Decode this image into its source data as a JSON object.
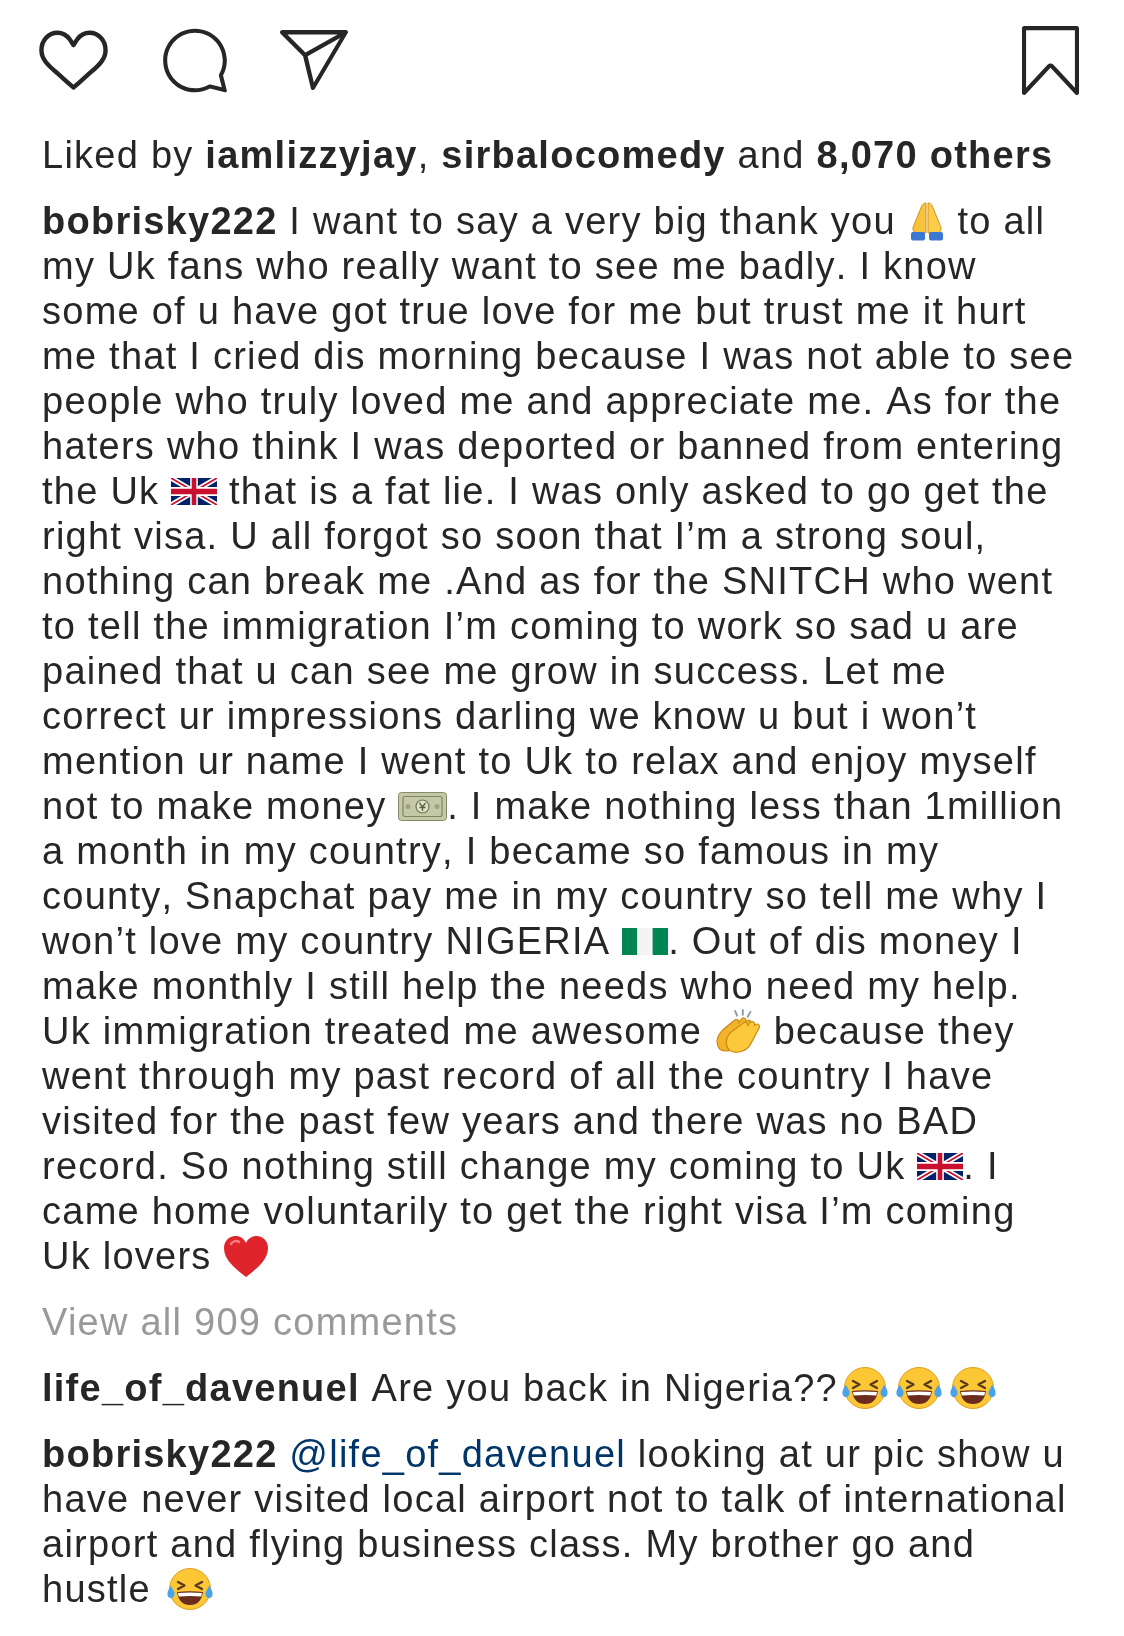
{
  "likes": {
    "text": "Liked by **iamlizzyjay**, **sirbalocomedy** and **8,070 others**"
  },
  "caption": {
    "segments": [
      {
        "kind": "text",
        "text": "**bobrisky222** I want to say a very big thank you "
      },
      {
        "kind": "praying_hands"
      },
      {
        "kind": "text",
        "text": " to all my Uk fans who really want to see me badly. I know some of u have got true love for me but trust me it hurt me that I cried dis morning because I was not able to see people who truly loved me and appreciate me. As for the haters who think I was deported or banned from entering the Uk "
      },
      {
        "kind": "flag_uk"
      },
      {
        "kind": "text",
        "text": " that is a fat lie. I was only asked to go get the right visa. U all forgot so soon that I’m a strong soul, nothing can break me .And as for the SNITCH who went to tell the immigration I’m coming to work so sad u are pained that u can see me grow in success. Let me correct ur impressions darling we know u but i won’t mention ur name I went to Uk to relax and enjoy myself not to make money "
      },
      {
        "kind": "banknote"
      },
      {
        "kind": "text",
        "text": ". I make nothing less than 1million a month in my country, I became so famous in my county, Snapchat pay me in my country so tell me why I won’t love my country NIGERIA "
      },
      {
        "kind": "flag_ng"
      },
      {
        "kind": "text",
        "text": ". Out of dis money I make monthly I still help the needs who need my help. Uk immigration treated me awesome "
      },
      {
        "kind": "clapping_hands"
      },
      {
        "kind": "text",
        "text": " because they went through my past record of all the country I have visited for the past few years and there was no BAD record. So nothing still change my coming to Uk "
      },
      {
        "kind": "flag_uk"
      },
      {
        "kind": "text",
        "text": ". I came home voluntarily to get the right visa I’m coming Uk lovers "
      },
      {
        "kind": "heart"
      }
    ]
  },
  "view_all_comments": "View all 909 comments",
  "comments": [
    {
      "segments": [
        {
          "kind": "text",
          "text": "**life_of_davenuel** Are you back in Nigeria??"
        },
        {
          "kind": "laughing_face"
        },
        {
          "kind": "laughing_face"
        },
        {
          "kind": "laughing_face"
        }
      ]
    },
    {
      "segments": [
        {
          "kind": "text",
          "text": "**bobrisky222** "
        },
        {
          "kind": "mention",
          "text": "@life_of_davenuel"
        },
        {
          "kind": "text",
          "text": " looking at ur pic show u have never visited local airport not to talk of international airport and flying business class. My brother go and hustle "
        },
        {
          "kind": "laughing_face"
        }
      ]
    }
  ]
}
